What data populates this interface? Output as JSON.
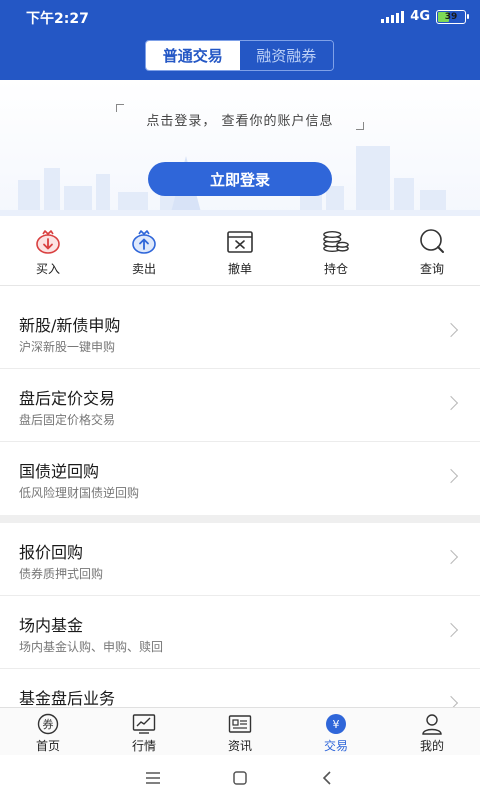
{
  "status": {
    "time": "下午2:27",
    "network": "4G",
    "battery": "39",
    "battery_fraction": 0.39
  },
  "tabs": {
    "normal": "普通交易",
    "margin": "融资融券"
  },
  "login": {
    "prompt": "点击登录， 查看你的账户信息",
    "button": "立即登录"
  },
  "quick_actions": [
    {
      "label": "买入",
      "icon": "buy-icon"
    },
    {
      "label": "卖出",
      "icon": "sell-icon"
    },
    {
      "label": "撤单",
      "icon": "cancel-order-icon"
    },
    {
      "label": "持仓",
      "icon": "holdings-icon"
    },
    {
      "label": "查询",
      "icon": "query-icon"
    }
  ],
  "menu": [
    {
      "title": "新股/新债申购",
      "subtitle": "沪深新股一键申购"
    },
    {
      "title": "盘后定价交易",
      "subtitle": "盘后固定价格交易"
    },
    {
      "title": "国债逆回购",
      "subtitle": "低风险理财国债逆回购"
    },
    {
      "title": "报价回购",
      "subtitle": "债券质押式回购"
    },
    {
      "title": "场内基金",
      "subtitle": "场内基金认购、申购、赎回"
    },
    {
      "title": "基金盘后业务",
      "subtitle": ""
    }
  ],
  "tabbar": [
    {
      "label": "首页",
      "icon": "home-icon",
      "glyph": "券"
    },
    {
      "label": "行情",
      "icon": "market-icon"
    },
    {
      "label": "资讯",
      "icon": "news-icon"
    },
    {
      "label": "交易",
      "icon": "trade-icon",
      "glyph": "¥",
      "active": true
    },
    {
      "label": "我的",
      "icon": "profile-icon"
    }
  ],
  "colors": {
    "brand": "#2457c5",
    "button": "#2f66d9",
    "buy": "#d94040",
    "sell": "#2f66d9"
  }
}
